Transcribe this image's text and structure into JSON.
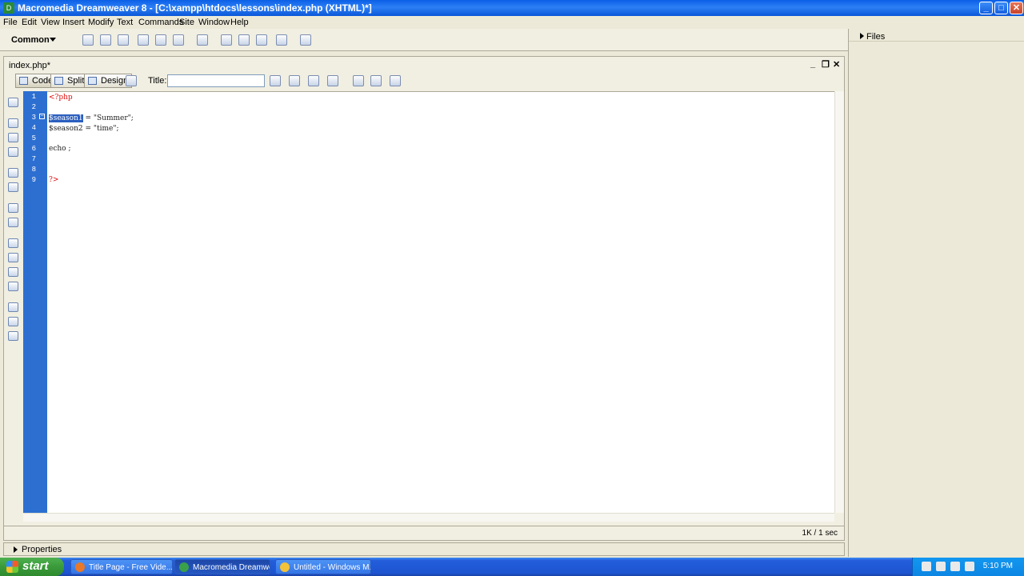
{
  "window": {
    "title": "Macromedia Dreamweaver 8 - [C:\\xampp\\htdocs\\lessons\\index.php (XHTML)*]",
    "minimize": "_",
    "maximize": "□",
    "close": "✕"
  },
  "menu": [
    "File",
    "Edit",
    "View",
    "Insert",
    "Modify",
    "Text",
    "Commands",
    "Site",
    "Window",
    "Help"
  ],
  "insert_bar": {
    "category": "Common"
  },
  "files_panel": {
    "label": "Files"
  },
  "document": {
    "tab": "index.php*",
    "controls": {
      "minimize": "_",
      "restore": "❐",
      "close": "✕"
    },
    "view_buttons": {
      "code": "Code",
      "split": "Split",
      "design": "Design"
    },
    "title_label": "Title:",
    "title_value": "",
    "status": "1K / 1 sec"
  },
  "code": {
    "line_numbers": [
      "1",
      "2",
      "3",
      "4",
      "5",
      "6",
      "7",
      "8",
      "9"
    ],
    "open_tag": "<?php",
    "line3_var": "$season1",
    "line3_rest": " = \"Summer\";",
    "line4": "$season2 = \"time\";",
    "line6": "echo ;",
    "close_tag": "?>"
  },
  "properties": {
    "label": "Properties"
  },
  "taskbar": {
    "start": "start",
    "tasks": [
      "Title Page - Free Vide...",
      "Macromedia Dreamwe...",
      "Untitled - Windows M..."
    ],
    "clock": "5:10 PM"
  },
  "colors": {
    "gutter": "#2d6fd1",
    "php_tag": "#e01010",
    "selection": "#2b5fbf",
    "titlebar": "#0a5fe6"
  }
}
